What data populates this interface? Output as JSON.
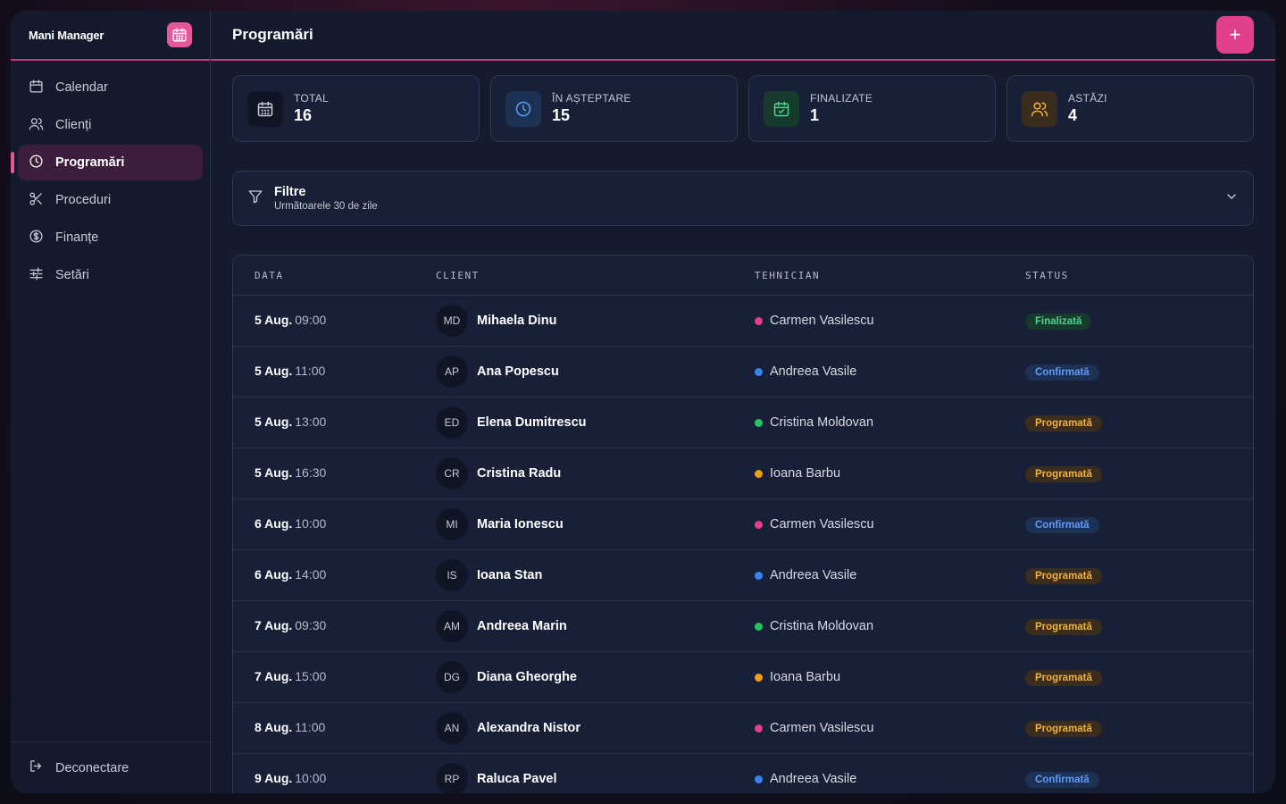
{
  "app": {
    "name": "Mani Manager"
  },
  "sidebar": {
    "items": [
      {
        "label": "Calendar",
        "icon": "calendar-icon"
      },
      {
        "label": "Clienți",
        "icon": "users-icon"
      },
      {
        "label": "Programări",
        "icon": "clock-icon",
        "active": true
      },
      {
        "label": "Proceduri",
        "icon": "scissors-icon"
      },
      {
        "label": "Finanțe",
        "icon": "dollar-icon"
      },
      {
        "label": "Setări",
        "icon": "sliders-icon"
      }
    ],
    "logout_label": "Deconectare"
  },
  "header": {
    "title": "Programări",
    "add_label": "+"
  },
  "stats": [
    {
      "label": "TOTAL",
      "value": "16",
      "icon": "calendar-icon",
      "color": "#c9ccd6"
    },
    {
      "label": "ÎN AȘTEPTARE",
      "value": "15",
      "icon": "clock-icon",
      "color": "#5d9cf5"
    },
    {
      "label": "FINALIZATE",
      "value": "1",
      "icon": "calendar-check-icon",
      "color": "#4cd48c"
    },
    {
      "label": "ASTĂZI",
      "value": "4",
      "icon": "users-icon",
      "color": "#f0b23c"
    }
  ],
  "filters": {
    "title": "Filtre",
    "subtitle": "Următoarele 30 de zile"
  },
  "table": {
    "columns": [
      "DATA",
      "CLIENT",
      "TEHNICIAN",
      "STATUS"
    ],
    "rows": [
      {
        "date": "5 Aug.",
        "time": "09:00",
        "initials": "MD",
        "client": "Mihaela Dinu",
        "tech": "Carmen Vasilescu",
        "tech_color": "#e23f8c",
        "status": "Finalizată",
        "status_type": "fin"
      },
      {
        "date": "5 Aug.",
        "time": "11:00",
        "initials": "AP",
        "client": "Ana Popescu",
        "tech": "Andreea Vasile",
        "tech_color": "#3b82f6",
        "status": "Confirmată",
        "status_type": "conf"
      },
      {
        "date": "5 Aug.",
        "time": "13:00",
        "initials": "ED",
        "client": "Elena Dumitrescu",
        "tech": "Cristina Moldovan",
        "tech_color": "#22c55e",
        "status": "Programată",
        "status_type": "prog"
      },
      {
        "date": "5 Aug.",
        "time": "16:30",
        "initials": "CR",
        "client": "Cristina Radu",
        "tech": "Ioana Barbu",
        "tech_color": "#f59e0b",
        "status": "Programată",
        "status_type": "prog"
      },
      {
        "date": "6 Aug.",
        "time": "10:00",
        "initials": "MI",
        "client": "Maria Ionescu",
        "tech": "Carmen Vasilescu",
        "tech_color": "#e23f8c",
        "status": "Confirmată",
        "status_type": "conf"
      },
      {
        "date": "6 Aug.",
        "time": "14:00",
        "initials": "IS",
        "client": "Ioana Stan",
        "tech": "Andreea Vasile",
        "tech_color": "#3b82f6",
        "status": "Programată",
        "status_type": "prog"
      },
      {
        "date": "7 Aug.",
        "time": "09:30",
        "initials": "AM",
        "client": "Andreea Marin",
        "tech": "Cristina Moldovan",
        "tech_color": "#22c55e",
        "status": "Programată",
        "status_type": "prog"
      },
      {
        "date": "7 Aug.",
        "time": "15:00",
        "initials": "DG",
        "client": "Diana Gheorghe",
        "tech": "Ioana Barbu",
        "tech_color": "#f59e0b",
        "status": "Programată",
        "status_type": "prog"
      },
      {
        "date": "8 Aug.",
        "time": "11:00",
        "initials": "AN",
        "client": "Alexandra Nistor",
        "tech": "Carmen Vasilescu",
        "tech_color": "#e23f8c",
        "status": "Programată",
        "status_type": "prog"
      },
      {
        "date": "9 Aug.",
        "time": "10:00",
        "initials": "RP",
        "client": "Raluca Pavel",
        "tech": "Andreea Vasile",
        "tech_color": "#3b82f6",
        "status": "Confirmată",
        "status_type": "conf"
      }
    ]
  }
}
